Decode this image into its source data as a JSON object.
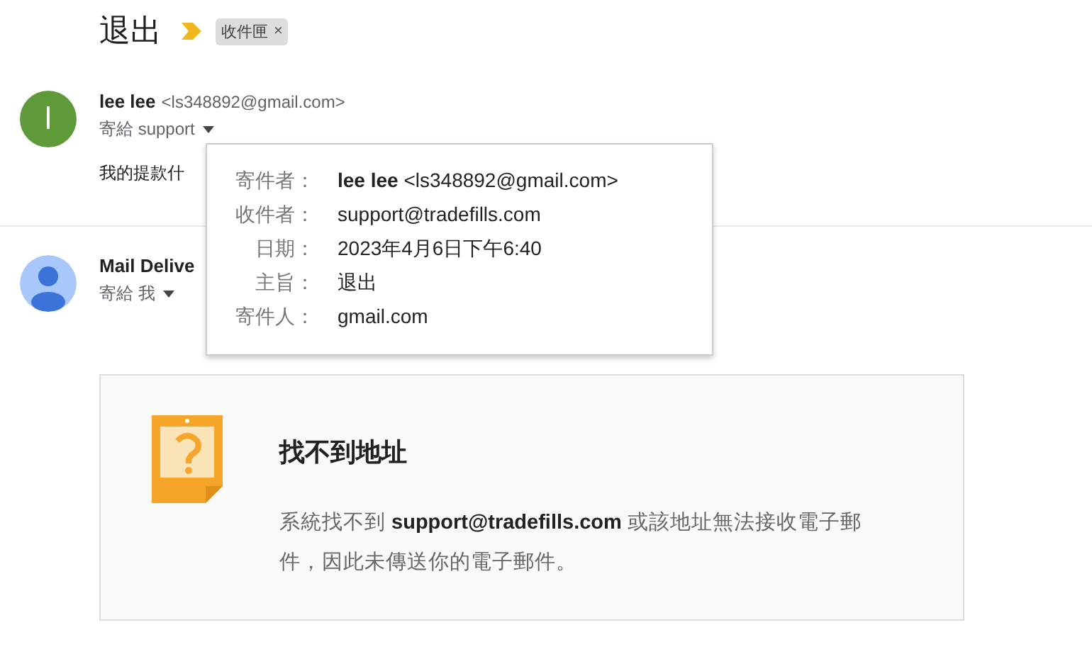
{
  "subject": "退出",
  "labels": [
    {
      "text": "收件匣",
      "close": "×"
    }
  ],
  "messages": [
    {
      "avatar": {
        "kind": "initial",
        "letter": "l",
        "color": "#5e9a3a"
      },
      "sender_name": "lee lee",
      "sender_email": "<ls348892@gmail.com>",
      "recipient_line": "寄給 support",
      "snippet": "我的提款什"
    },
    {
      "avatar": {
        "kind": "person",
        "color": "#a8c7fa"
      },
      "sender_name": "Mail Delive",
      "recipient_line": "寄給 我"
    }
  ],
  "details_popup": {
    "rows": [
      {
        "label": "寄件者：",
        "value": "**lee lee** <ls348892@gmail.com>"
      },
      {
        "label": "收件者：",
        "value": "support@tradefills.com"
      },
      {
        "label": "日期：",
        "value": "2023年4月6日下午6:40"
      },
      {
        "label": "主旨：",
        "value": "退出"
      },
      {
        "label": "寄件人：",
        "value": "gmail.com"
      }
    ]
  },
  "bounce_notice": {
    "heading": "找不到地址",
    "body": "系統找不到 **support@tradefills.com** 或該地址無法接收電子郵件，因此未傳送你的電子郵件。"
  }
}
